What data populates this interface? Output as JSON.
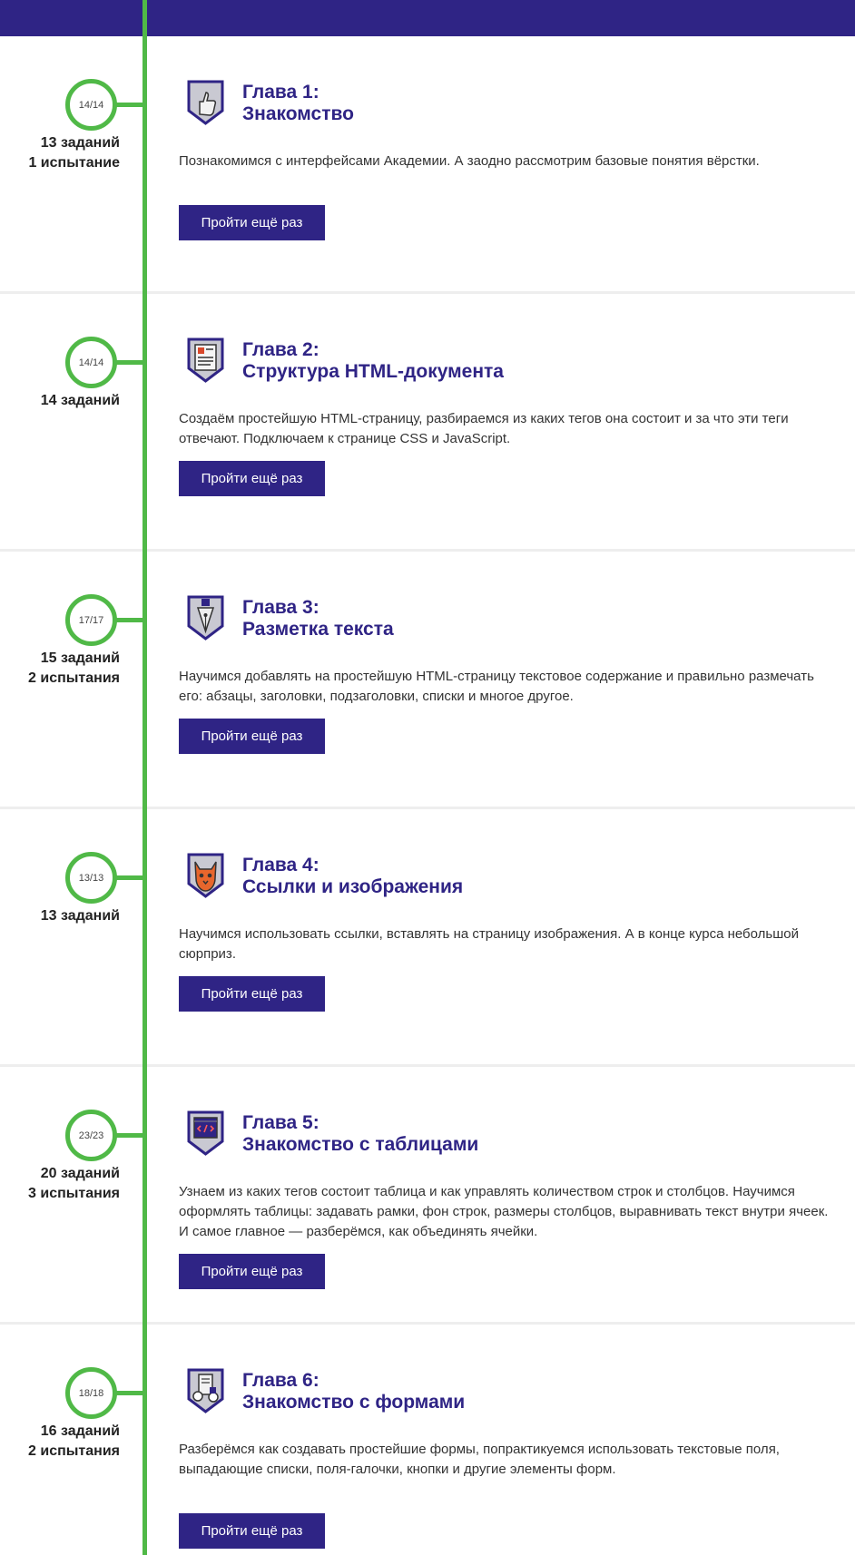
{
  "chapters": [
    {
      "progress": "14/14",
      "stats": [
        "13 заданий",
        "1 испытание"
      ],
      "icon": "thumbs-up-shield-icon",
      "title_line1": "Глава 1:",
      "title_line2": "Знакомство",
      "description": "Познакомимся с интерфейсами Академии. А заодно рассмотрим базовые понятия вёрстки.",
      "button": "Пройти ещё раз"
    },
    {
      "progress": "14/14",
      "stats": [
        "14 заданий"
      ],
      "icon": "document-shield-icon",
      "title_line1": "Глава 2:",
      "title_line2": "Структура HTML-документа",
      "description": "Создаём простейшую HTML-страницу, разбираемся из каких тегов она состоит и за что эти теги отвечают. Подключаем к странице CSS и JavaScript.",
      "button": "Пройти ещё раз"
    },
    {
      "progress": "17/17",
      "stats": [
        "15 заданий",
        "2 испытания"
      ],
      "icon": "pen-nib-shield-icon",
      "title_line1": "Глава 3:",
      "title_line2": "Разметка текста",
      "description": "Научимся добавлять на простейшую HTML-страницу текстовое содержание и правильно размечать его: абзацы, заголовки, подзаголовки, списки и многое другое.",
      "button": "Пройти ещё раз"
    },
    {
      "progress": "13/13",
      "stats": [
        "13 заданий"
      ],
      "icon": "cat-shield-icon",
      "title_line1": "Глава 4:",
      "title_line2": "Ссылки и изображения",
      "description": "Научимся использовать ссылки, вставлять на страницу изображения. А в конце курса небольшой сюрприз.",
      "button": "Пройти ещё раз"
    },
    {
      "progress": "23/23",
      "stats": [
        "20 заданий",
        "3 испытания"
      ],
      "icon": "code-window-shield-icon",
      "title_line1": "Глава 5:",
      "title_line2": "Знакомство с таблицами",
      "description": "Узнаем из каких тегов состоит таблица и как управлять количеством строк и столбцов. Научимся оформлять таблицы: задавать рамки, фон строк, размеры столбцов, выравнивать текст внутри ячеек. И самое главное — разберёмся, как объединять ячейки.",
      "button": "Пройти ещё раз"
    },
    {
      "progress": "18/18",
      "stats": [
        "16 заданий",
        "2 испытания"
      ],
      "icon": "form-elements-shield-icon",
      "title_line1": "Глава 6:",
      "title_line2": "Знакомство с формами",
      "description": "Разберёмся как создавать простейшие формы, попрактикуемся использовать текстовые поля, выпадающие списки, поля-галочки, кнопки и другие элементы форм.",
      "button": "Пройти ещё раз"
    }
  ],
  "colors": {
    "brand": "#2f2485",
    "timeline": "#50b947",
    "divider": "#eeeeee"
  }
}
